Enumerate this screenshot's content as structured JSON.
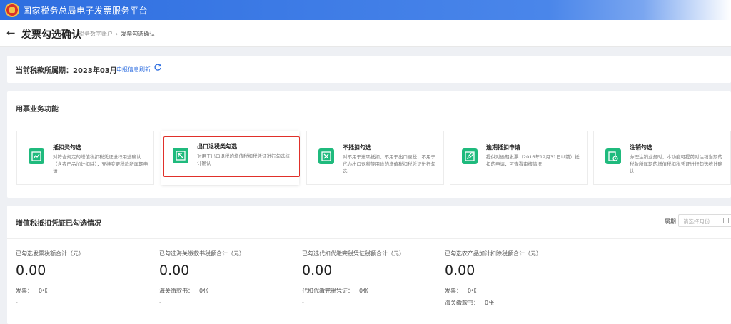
{
  "header": {
    "title": "国家税务总局电子发票服务平台"
  },
  "subheader": {
    "page_title": "发票勾选确认",
    "breadcrumb": [
      "税务数字账户",
      "发票勾选确认"
    ]
  },
  "period": {
    "label": "当前税款所属期：2023年03月",
    "refresh_label": "申报信息刷新"
  },
  "business": {
    "title": "用票业务功能",
    "cards": [
      {
        "title": "抵扣类勾选",
        "desc": "对符合规定的增值税扣税凭证进行用途确认（含农产品加计扣除），支持变更税款所属期申请"
      },
      {
        "title": "出口退税类勾选",
        "desc": "对用于出口退税的增值税扣税凭证进行勾选统计确认"
      },
      {
        "title": "不抵扣勾选",
        "desc": "对不用于进项抵扣、不用于出口退税、不用于代办出口退税等用途的增值税扣税凭证进行勾选"
      },
      {
        "title": "逾期抵扣申请",
        "desc": "提供对逾期发票（2016年12月31日以前）抵扣的申请，可查看审核情况"
      },
      {
        "title": "注销勾选",
        "desc": "办理注销业务时，本功能可提前对注销当期的税款所属期的增值税扣税凭证进行勾选统计确认"
      }
    ]
  },
  "summary": {
    "title": "增值税抵扣凭证已勾选情况",
    "period_label": "属期",
    "period_placeholder": "请选择月份",
    "stats": [
      {
        "label": "已勾选发票税额合计（元）",
        "value": "0.00",
        "rows": [
          {
            "k": "发票：",
            "v": "0张"
          }
        ],
        "dash": "-"
      },
      {
        "label": "已勾选海关缴款书税额合计（元）",
        "value": "0.00",
        "rows": [
          {
            "k": "海关缴款书：",
            "v": "0张"
          }
        ],
        "dash": "-"
      },
      {
        "label": "已勾选代扣代缴完税凭证税额合计（元）",
        "value": "0.00",
        "rows": [
          {
            "k": "代扣代缴完税凭证：",
            "v": "0张"
          }
        ],
        "dash": "-"
      },
      {
        "label": "已勾选农产品加计扣除税额合计（元）",
        "value": "0.00",
        "rows": [
          {
            "k": "发票：",
            "v": "0张"
          },
          {
            "k": "海关缴款书：",
            "v": "0张"
          }
        ],
        "dash": ""
      }
    ]
  }
}
